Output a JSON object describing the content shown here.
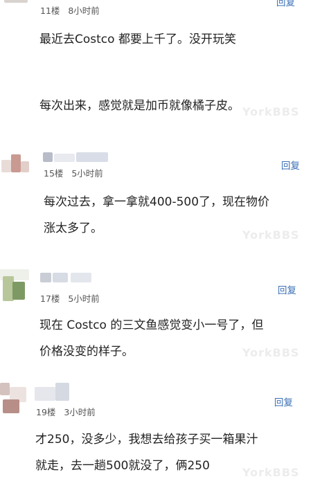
{
  "comments": [
    {
      "floor": "11楼",
      "time": "8小时前",
      "reply": "回复",
      "lines": [
        "最近去Costco 都要上千了。没开玩笑",
        "",
        "每次出来，感觉就是加币就像橘子皮。"
      ]
    },
    {
      "floor": "15楼",
      "time": "5小时前",
      "reply": "回复",
      "lines": [
        "每次过去，拿一拿就400-500了，现在物价",
        "涨太多了。"
      ]
    },
    {
      "floor": "17楼",
      "time": "5小时前",
      "reply": "回复",
      "lines": [
        "现在 Costco 的三文鱼感觉变小一号了，但",
        "价格没变的样子。"
      ]
    },
    {
      "floor": "19楼",
      "time": "3小时前",
      "reply": "回复",
      "lines": [
        "才250，没多少，我想去给孩子买一箱果汁",
        "就走，去一趟500就没了，俩250"
      ]
    }
  ],
  "watermark": "YorkBBS",
  "colors": {
    "reply": "#3a6fb5",
    "meta": "#555555",
    "text": "#222222"
  }
}
